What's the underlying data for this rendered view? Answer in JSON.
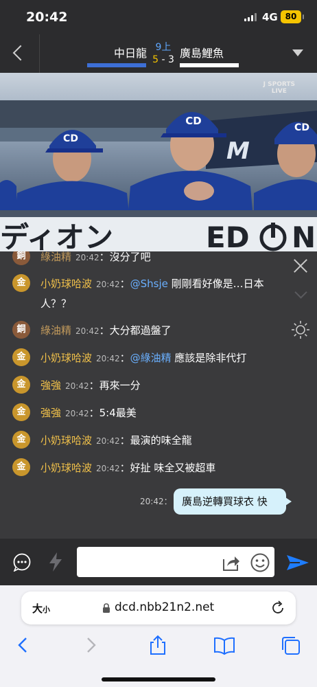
{
  "status_bar": {
    "time": "20:42",
    "network": "4G",
    "battery": "80"
  },
  "game": {
    "home_team": "中日龍",
    "away_team": "廣島鯉魚",
    "inning": "9上",
    "home_score": "5",
    "score_separator": " - ",
    "away_score": "3",
    "home_color": "#3d6fd6",
    "away_color": "#ffffff"
  },
  "video": {
    "broadcaster": "J SPORTS",
    "live_label": "LIVE",
    "banner_left": "ディオン",
    "banner_right": "ED"
  },
  "chat": {
    "messages": [
      {
        "rank": "銅",
        "user": "綠油精",
        "time": "20:42",
        "mention": "",
        "text": "沒分了吧"
      },
      {
        "rank": "金",
        "user": "小奶球哈波",
        "time": "20:42",
        "mention": "@Shsje",
        "text": " 剛剛看好像是…日本人？？"
      },
      {
        "rank": "銅",
        "user": "綠油精",
        "time": "20:42",
        "mention": "",
        "text": "大分都過盤了"
      },
      {
        "rank": "金",
        "user": "小奶球哈波",
        "time": "20:42",
        "mention": "@綠油精",
        "text": " 應該是除非代打"
      },
      {
        "rank": "金",
        "user": "強強",
        "time": "20:42",
        "mention": "",
        "text": "再來一分"
      },
      {
        "rank": "金",
        "user": "強強",
        "time": "20:42",
        "mention": "",
        "text": "5:4最美"
      },
      {
        "rank": "金",
        "user": "小奶球哈波",
        "time": "20:42",
        "mention": "",
        "text": "最演的味全龍"
      },
      {
        "rank": "金",
        "user": "小奶球哈波",
        "time": "20:42",
        "mention": "",
        "text": "好扯  味全又被超車"
      }
    ],
    "colon": "：",
    "my_message": {
      "time": "20:42",
      "colon": "：",
      "text": "廣島逆轉買球衣  快"
    }
  },
  "input": {
    "placeholder": ""
  },
  "browser": {
    "text_size_label": "大",
    "text_size_small": "小",
    "url": "dcd.nbb21n2.net"
  }
}
